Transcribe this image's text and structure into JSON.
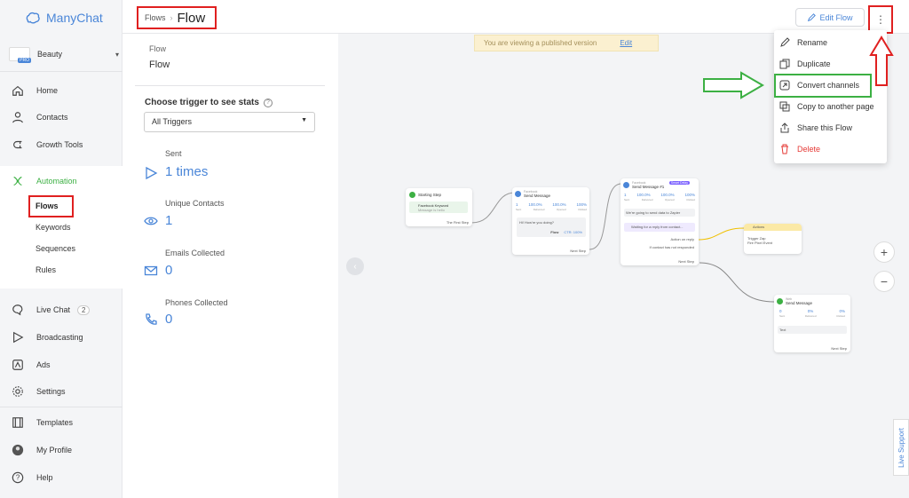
{
  "app": {
    "name": "ManyChat",
    "account": "Beauty",
    "account_badge": "PRO"
  },
  "sidebar": {
    "items": [
      {
        "label": "Home"
      },
      {
        "label": "Contacts"
      },
      {
        "label": "Growth Tools"
      },
      {
        "label": "Automation"
      },
      {
        "label": "Live Chat",
        "badge": "2"
      },
      {
        "label": "Broadcasting"
      },
      {
        "label": "Ads"
      },
      {
        "label": "Settings"
      },
      {
        "label": "Templates"
      },
      {
        "label": "My Profile"
      },
      {
        "label": "Help"
      }
    ],
    "automation_sub": [
      "Flows",
      "Keywords",
      "Sequences",
      "Rules"
    ]
  },
  "header": {
    "breadcrumb": "Flows",
    "title": "Flow",
    "edit_button": "Edit Flow",
    "more": "⋮"
  },
  "panel": {
    "flow_label": "Flow",
    "flow_name": "Flow",
    "trigger_heading": "Choose trigger to see stats",
    "trigger_select": "All Triggers",
    "stats": [
      {
        "label": "Sent",
        "value": "1 times"
      },
      {
        "label": "Unique Contacts",
        "value": "1"
      },
      {
        "label": "Emails Collected",
        "value": "0"
      },
      {
        "label": "Phones Collected",
        "value": "0"
      }
    ]
  },
  "canvas": {
    "notice": "You are viewing a published version",
    "notice_link": "Edit",
    "zoom_in": "+",
    "zoom_out": "−",
    "collapse": "‹",
    "live_support": "Live Support"
  },
  "nodes": {
    "start": {
      "title": "Starting Step",
      "trigger": "Facebook Keyword",
      "trigger_sub": "Message is hello",
      "next": "The First Step"
    },
    "msg1": {
      "kind": "Facebook",
      "title": "Send Message",
      "stats": [
        "1",
        "100.0%",
        "100.0%",
        "100%"
      ],
      "stat_labels": [
        "Sent",
        "Delivered",
        "Opened",
        "Clicked"
      ],
      "text": "Hi! How're you doing?",
      "button": "Flow",
      "button_sub": "CTR: 100%",
      "next": "Next Step"
    },
    "msg2": {
      "kind": "Facebook",
      "title": "Send Message #1",
      "tag": "Smart Delay",
      "stats": [
        "1",
        "100.0%",
        "100.0%",
        "100%"
      ],
      "stat_labels": [
        "Sent",
        "Delivered",
        "Opened",
        "Clicked"
      ],
      "text": "We're going to send data to Zapier",
      "wait": "Waiting for a reply from contact...",
      "reply": "Action on reply",
      "noreply": "If contact has not responded",
      "next": "Next Step"
    },
    "actions": {
      "title": "Actions",
      "line1": "Trigger Zap",
      "line2": "Fire Pixel Event"
    },
    "msg3": {
      "kind": "Web",
      "title": "Send Message",
      "stats": [
        "0",
        "0%",
        "0%"
      ],
      "stat_labels": [
        "Sent",
        "Delivered",
        "Clicked"
      ],
      "text": "Text",
      "next": "Next Step"
    }
  },
  "menu": {
    "items": [
      "Rename",
      "Duplicate",
      "Convert channels",
      "Copy to another page",
      "Share this Flow",
      "Delete"
    ]
  },
  "colors": {
    "accent": "#4a86d8",
    "automation": "#3cb043",
    "delete": "#e53935",
    "highlight_red": "#e02020",
    "highlight_green": "#3cb043"
  }
}
